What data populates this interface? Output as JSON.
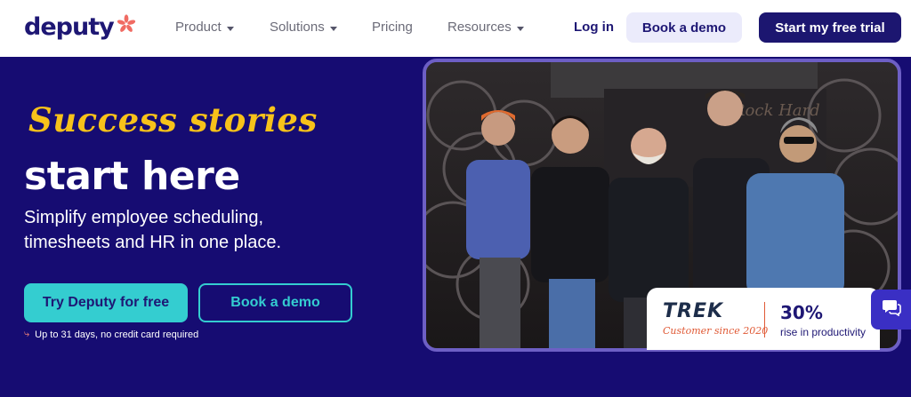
{
  "brand": {
    "logo_text": "deputy",
    "logo_icon": "asterisk-logo-icon"
  },
  "nav": {
    "items": [
      {
        "label": "Product",
        "has_dropdown": true
      },
      {
        "label": "Solutions",
        "has_dropdown": true
      },
      {
        "label": "Pricing",
        "has_dropdown": false
      },
      {
        "label": "Resources",
        "has_dropdown": true
      }
    ],
    "login": "Log in",
    "book_demo": "Book a demo",
    "free_trial": "Start my free trial"
  },
  "hero": {
    "script_heading": "Success stories",
    "main_heading": "start here",
    "subtext": "Simplify employee scheduling, timesheets and HR in one place.",
    "cta_primary": "Try Deputy for free",
    "cta_secondary": "Book a demo",
    "fineprint": "Up to 31 days, no credit card required"
  },
  "testimonial_card": {
    "brand": "TREK",
    "customer_since": "Customer since 2020",
    "stat_value": "30%",
    "stat_label": "rise in productivity"
  },
  "chat": {
    "icon": "chat-bubble-icon"
  },
  "colors": {
    "brand_navy": "#1e1774",
    "hero_bg": "#160c72",
    "accent_teal": "#34cdd0",
    "accent_yellow": "#f7c21a",
    "photo_border": "#6d5fc5",
    "trek_accent": "#e05a36"
  }
}
